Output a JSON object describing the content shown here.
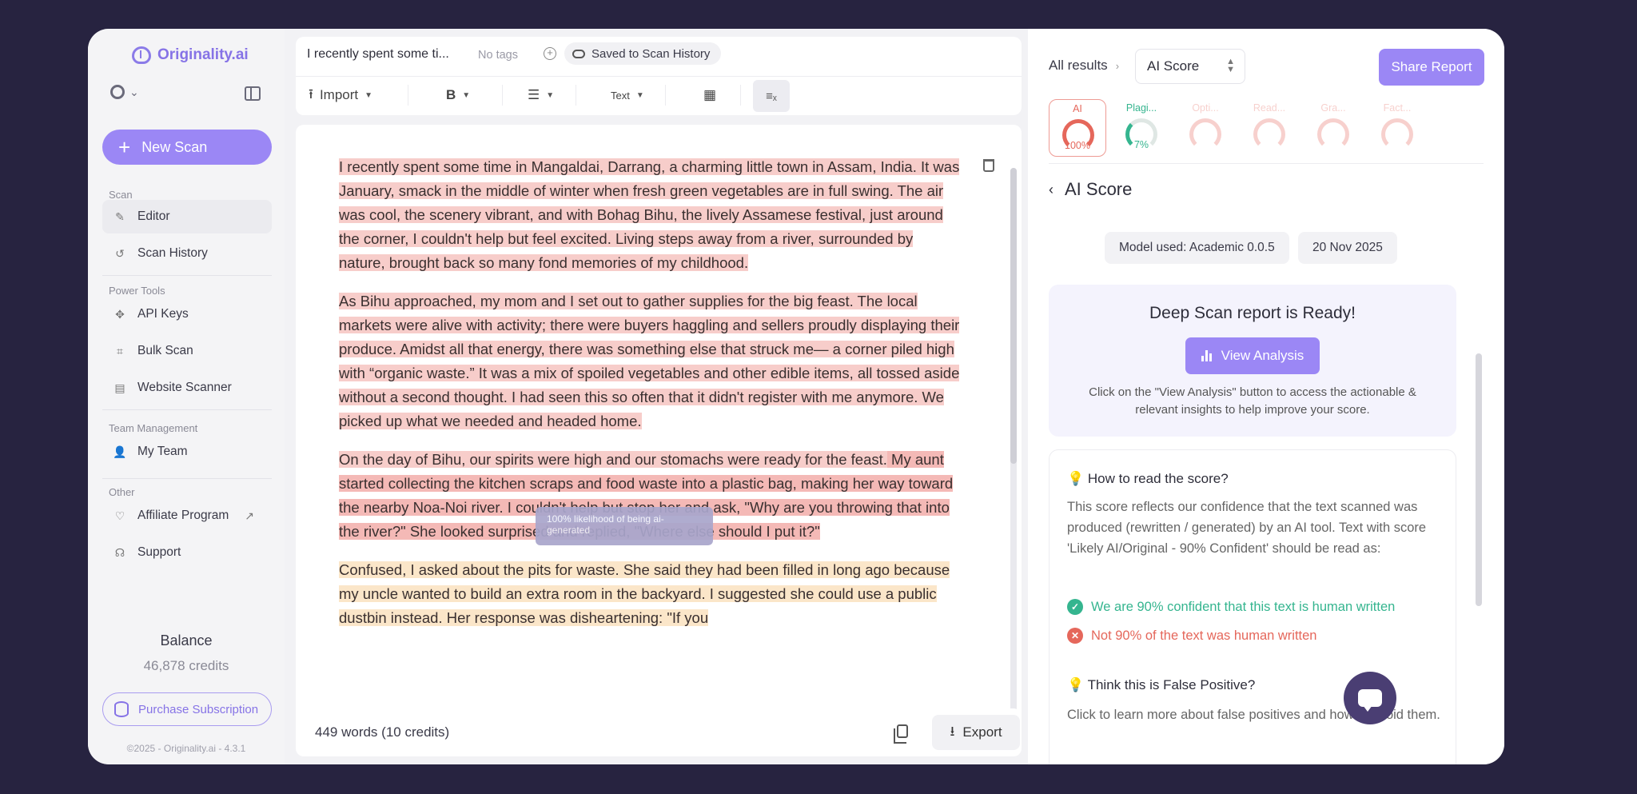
{
  "sidebar": {
    "brand": "Originality.ai",
    "new_scan": "New Scan",
    "sections": {
      "scan": "Scan",
      "power_tools": "Power Tools",
      "team_management": "Team Management",
      "other": "Other"
    },
    "items": {
      "editor": "Editor",
      "scan_history": "Scan History",
      "api_keys": "API Keys",
      "bulk_scan": "Bulk Scan",
      "website_scanner": "Website Scanner",
      "my_team": "My Team",
      "affiliate_program": "Affiliate Program",
      "support": "Support"
    },
    "balance_title": "Balance",
    "balance_value": "46,878 credits",
    "purchase": "Purchase Subscription",
    "copyright": "©2025 - Originality.ai - 4.3.1"
  },
  "editor": {
    "doc_title": "I recently spent some ti...",
    "no_tags": "No tags",
    "saved": "Saved to Scan History",
    "toolbar": {
      "import": "Import",
      "bold": "B",
      "text": "Text"
    },
    "paragraphs": {
      "p1": "I recently spent some time in Mangaldai, Darrang, a charming little town in Assam, India. It was January, smack in the middle of winter when fresh green vegetables are in full swing. The air was cool, the scenery vibrant, and with Bohag Bihu, the lively Assamese festival, just around the corner, I couldn't help but feel excited. Living steps away from a river, surrounded by nature, brought back so many fond memories of my childhood.",
      "p2": "As Bihu approached, my mom and I set out to gather supplies for the big feast. The local markets were alive with activity; there were buyers haggling and sellers proudly displaying their produce. Amidst all that energy, there was something else that struck me— a corner piled high with “organic waste.” It was a mix of spoiled vegetables and other edible items, all tossed aside without a second thought. I had seen this so often that it didn't register with me anymore. We picked up what we needed and headed home.",
      "p3a": "On the day of Bihu, our spirits were high and our stomachs were ready for the feast.",
      "p3b": " My aunt started collecting the kitchen scraps and food waste into a plastic bag, making her way toward the nearby Noa-Noi river. I couldn't help but stop her and ask, \"Why are you throwing that into the river?\" She looked surprised and replied, \"Where else should I put it?\"",
      "p4": "Confused, I asked about the pits for waste. She said they had been filled in long ago because my uncle wanted to build an extra room in the backyard. I suggested she could use a public dustbin instead. Her response was disheartening: \"If you"
    },
    "tooltip": "100% likelihood of being ai-generated",
    "word_count": "449 words (10 credits)",
    "export": "Export"
  },
  "results": {
    "breadcrumb": "All results",
    "selected": "AI Score",
    "share": "Share Report",
    "gauges": [
      {
        "label": "AI",
        "value": "100%",
        "level": 1.0,
        "color": "#e5675b"
      },
      {
        "label": "Plagi...",
        "value": "7%",
        "level": 0.07,
        "color": "#35b58f"
      },
      {
        "label": "Opti...",
        "value": "",
        "level": 0.5,
        "color": "#e5675b"
      },
      {
        "label": "Read...",
        "value": "",
        "level": 0.5,
        "color": "#e5675b"
      },
      {
        "label": "Gra...",
        "value": "",
        "level": 0.5,
        "color": "#e5675b"
      },
      {
        "label": "Fact...",
        "value": "",
        "level": 0.5,
        "color": "#e5675b"
      }
    ],
    "section_title": "AI Score",
    "model": "Model used: Academic 0.0.5",
    "date": "20 Nov 2025",
    "deep_title": "Deep Scan report is Ready!",
    "view_analysis": "View Analysis",
    "deep_desc": "Click on the \"View Analysis\" button to access the actionable & relevant insights to help improve your score.",
    "howto_title": "How to read the score?",
    "howto_desc": "This score reflects our confidence that the text scanned was produced (rewritten / generated) by an AI tool. Text with score 'Likely AI/Original - 90% Confident' should be read as:",
    "check_true": "We are 90% confident that this text is human written",
    "check_false": "Not 90% of the text was human written",
    "fp_title": "Think this is False Positive?",
    "fp_desc": "Click to learn more about false positives and how to avoid them."
  },
  "colors": {
    "accent": "#9b87f5",
    "ai_red": "#e5675b",
    "human_green": "#35b58f"
  }
}
